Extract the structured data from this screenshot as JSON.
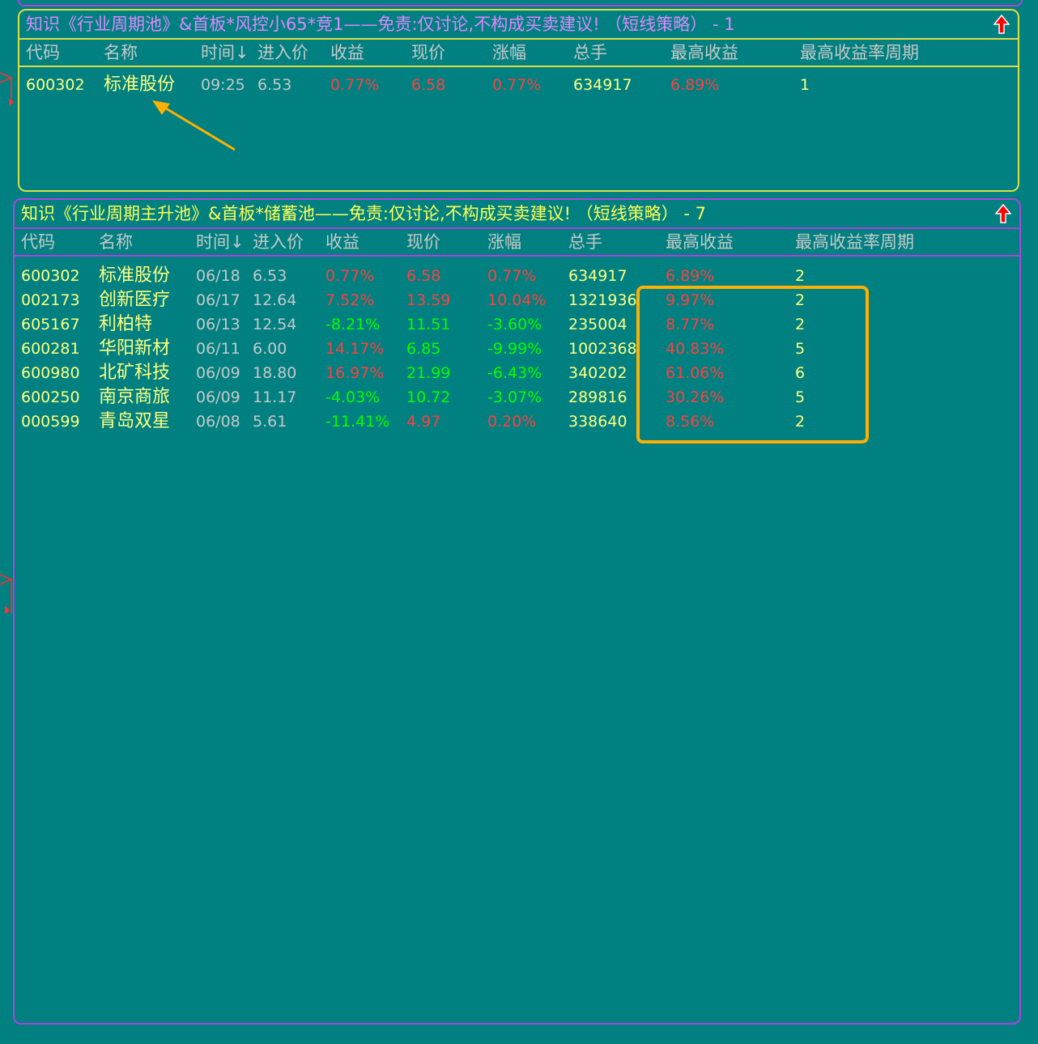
{
  "panel1": {
    "title": "知识《行业周期池》&首板*风控小65*竞1——免责:仅讨论,不构成买卖建议!  （短线策略） - 1",
    "headers": [
      "代码",
      "名称",
      "时间↓",
      "进入价",
      "收益",
      "现价",
      "涨幅",
      "总手",
      "最高收益",
      "最高收益率周期"
    ],
    "rows": [
      {
        "code": "600302",
        "name": "标准股份",
        "time": "09:25",
        "entry": "6.53",
        "gain": "0.77%",
        "price": "6.58",
        "change": "0.77%",
        "volume": "634917",
        "max_gain": "6.89%",
        "period": "1",
        "gain_color": "red",
        "price_color": "red",
        "change_color": "red"
      }
    ]
  },
  "panel2": {
    "title": "知识《行业周期主升池》&首板*储蓄池——免责:仅讨论,不构成买卖建议!  （短线策略） - 7",
    "headers": [
      "代码",
      "名称",
      "时间↓",
      "进入价",
      "收益",
      "现价",
      "涨幅",
      "总手",
      "最高收益",
      "最高收益率周期"
    ],
    "rows": [
      {
        "code": "600302",
        "name": "标准股份",
        "time": "06/18",
        "entry": "6.53",
        "gain": "0.77%",
        "price": "6.58",
        "change": "0.77%",
        "volume": "634917",
        "max_gain": "6.89%",
        "period": "2",
        "gain_color": "red",
        "price_color": "red",
        "change_color": "red"
      },
      {
        "code": "002173",
        "name": "创新医疗",
        "time": "06/17",
        "entry": "12.64",
        "gain": "7.52%",
        "price": "13.59",
        "change": "10.04%",
        "volume": "1321936",
        "max_gain": "9.97%",
        "period": "2",
        "gain_color": "red",
        "price_color": "red",
        "change_color": "red"
      },
      {
        "code": "605167",
        "name": "利柏特",
        "time": "06/13",
        "entry": "12.54",
        "gain": "-8.21%",
        "price": "11.51",
        "change": "-3.60%",
        "volume": "235004",
        "max_gain": "8.77%",
        "period": "2",
        "gain_color": "green",
        "price_color": "green",
        "change_color": "green"
      },
      {
        "code": "600281",
        "name": "华阳新材",
        "time": "06/11",
        "entry": "6.00",
        "gain": "14.17%",
        "price": "6.85",
        "change": "-9.99%",
        "volume": "1002368",
        "max_gain": "40.83%",
        "period": "5",
        "gain_color": "red",
        "price_color": "green",
        "change_color": "green"
      },
      {
        "code": "600980",
        "name": "北矿科技",
        "time": "06/09",
        "entry": "18.80",
        "gain": "16.97%",
        "price": "21.99",
        "change": "-6.43%",
        "volume": "340202",
        "max_gain": "61.06%",
        "period": "6",
        "gain_color": "red",
        "price_color": "green",
        "change_color": "green"
      },
      {
        "code": "600250",
        "name": "南京商旅",
        "time": "06/09",
        "entry": "11.17",
        "gain": "-4.03%",
        "price": "10.72",
        "change": "-3.07%",
        "volume": "289816",
        "max_gain": "30.26%",
        "period": "5",
        "gain_color": "green",
        "price_color": "green",
        "change_color": "green"
      },
      {
        "code": "000599",
        "name": "青岛双星",
        "time": "06/08",
        "entry": "5.61",
        "gain": "-11.41%",
        "price": "4.97",
        "change": "0.20%",
        "volume": "338640",
        "max_gain": "8.56%",
        "period": "2",
        "gain_color": "green",
        "price_color": "red",
        "change_color": "red"
      }
    ]
  },
  "colors": {
    "background": "#008080",
    "panel1_border": "#dddd44",
    "panel2_border": "#aa44dd",
    "highlight": "#ffb000",
    "up": "#ff4040",
    "down": "#00ff00"
  },
  "icons": {
    "scroll_up": "red-up-arrow-icon",
    "annotation_arrow": "orange-arrow-icon"
  }
}
